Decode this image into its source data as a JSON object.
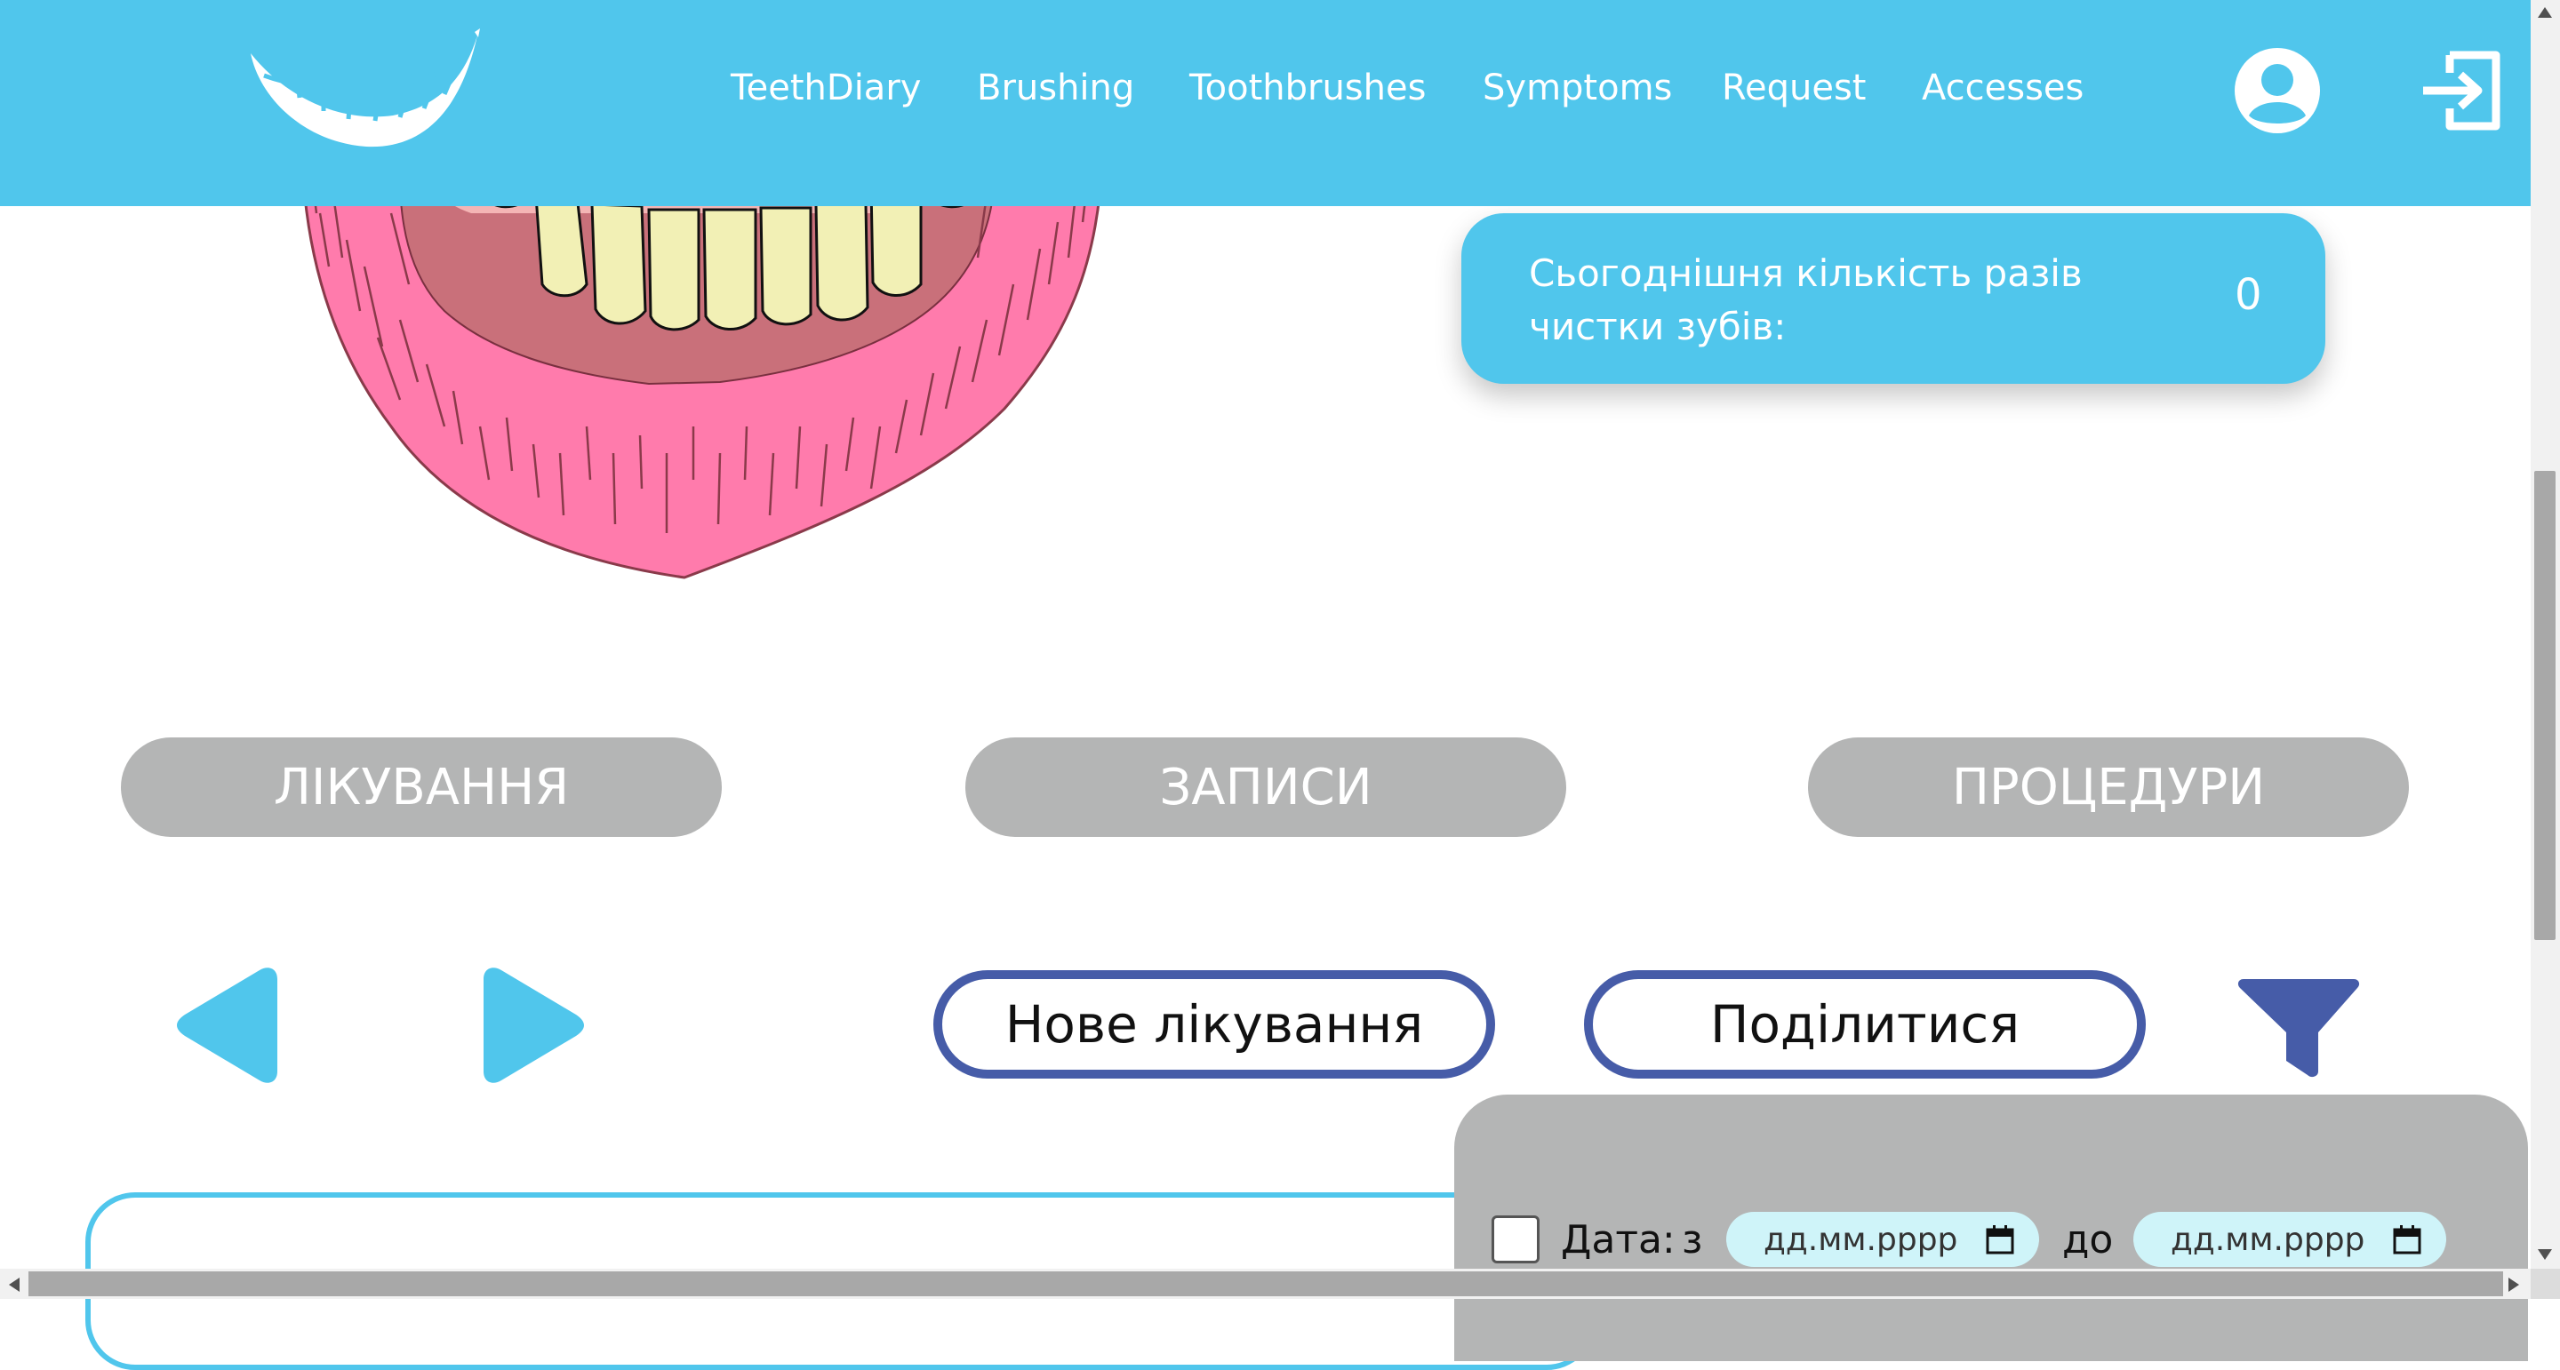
{
  "header": {
    "logo_icon": "teeth-feather-logo",
    "nav": [
      {
        "label": "TeethDiary"
      },
      {
        "label": "Brushing"
      },
      {
        "label": "Toothbrushes"
      },
      {
        "label": "Symptoms"
      },
      {
        "label": "Request"
      },
      {
        "label": "Accesses"
      }
    ],
    "avatar_icon": "user-circle-icon",
    "logout_icon": "logout-icon"
  },
  "counter": {
    "label": "Сьогоднішня кількість разів чистки зубів:",
    "value": "0"
  },
  "tabs": [
    {
      "label": "ЛІКУВАННЯ"
    },
    {
      "label": "ЗАПИСИ"
    },
    {
      "label": "ПРОЦЕДУРИ"
    }
  ],
  "actions": {
    "new_treatment": "Нове лікування",
    "share": "Поділитися"
  },
  "filter": {
    "date_label": "Дата:",
    "from_label": "з",
    "to_label": "до",
    "from_placeholder": "дд.мм.рррр",
    "to_placeholder": "дд.мм.рррр"
  },
  "colors": {
    "brand_blue": "#50c6ec",
    "tab_gray": "#b4b5b5",
    "button_border": "#465ca8",
    "lips_pink": "#ff7bac",
    "teeth_yellow": "#f2f0b5"
  }
}
